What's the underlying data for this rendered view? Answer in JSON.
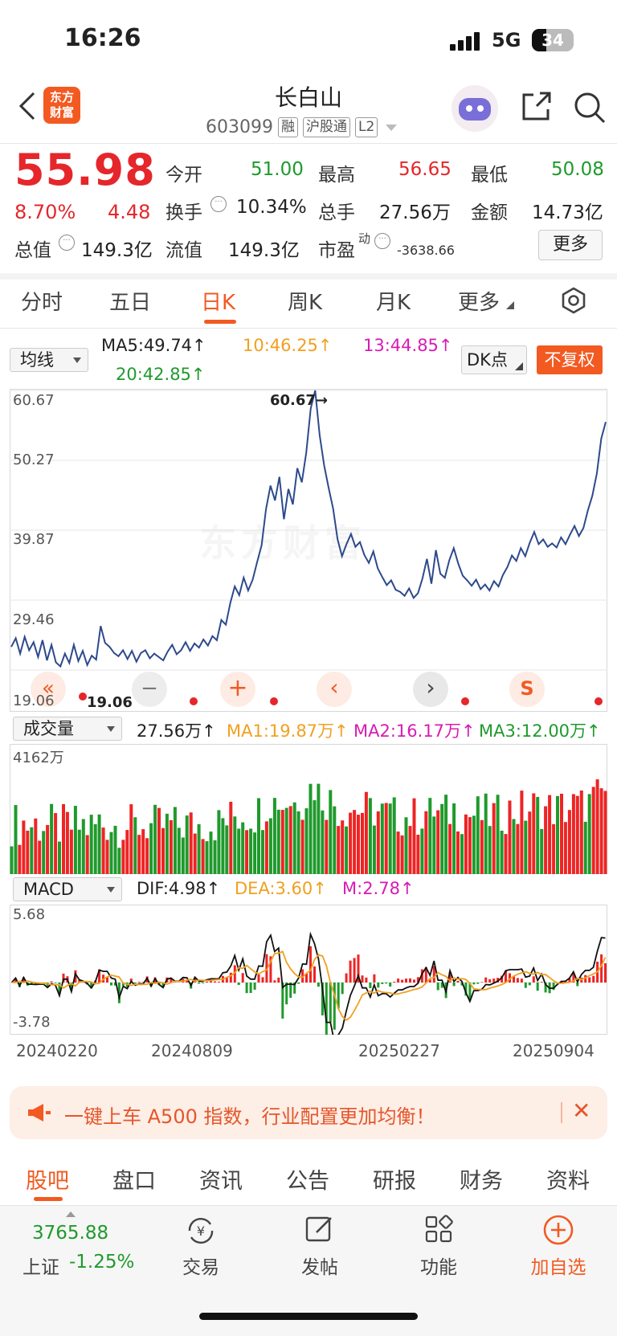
{
  "status_bar": {
    "time": "16:26",
    "network": "5G",
    "battery": "34",
    "battery_level": 0.34
  },
  "header": {
    "title": "长白山",
    "code": "603099",
    "tags": [
      "融",
      "沪股通",
      "L2"
    ],
    "logo_line1": "东方",
    "logo_line2": "财富"
  },
  "quote": {
    "price": "55.98",
    "change_pct": "8.70%",
    "change": "4.48",
    "labels": {
      "open": "今开",
      "high": "最高",
      "low": "最低",
      "turnover": "换手",
      "volume": "总手",
      "amount": "金额",
      "market_cap": "总值",
      "float_cap": "流值",
      "pe": "市盈",
      "pe_sup": "动"
    },
    "values": {
      "open": "51.00",
      "high": "56.65",
      "low": "50.08",
      "turnover": "10.34%",
      "volume": "27.56万",
      "amount": "14.73亿",
      "market_cap": "149.3亿",
      "float_cap": "149.3亿",
      "pe": "-3638.66"
    },
    "more_label": "更多"
  },
  "period_tabs": [
    "分时",
    "五日",
    "日K",
    "周K",
    "月K",
    "更多"
  ],
  "active_period": 2,
  "chart_legend": {
    "selector": "均线",
    "ma5": "MA5:49.74↑",
    "ma10": "10:46.25↑",
    "ma13": "13:44.85↑",
    "ma20": "20:42.85↑",
    "dk_label": "DK点",
    "fq_label": "不复权"
  },
  "volume_legend": {
    "selector": "成交量",
    "vol": "27.56万↑",
    "ma1": "MA1:19.87万↑",
    "ma2": "MA2:16.17万↑",
    "ma3": "MA3:12.00万↑",
    "max_label": "4162万"
  },
  "macd_legend": {
    "selector": "MACD",
    "dif": "DIF:4.98↑",
    "dea": "DEA:3.60↑",
    "m": "M:2.78↑",
    "max_label": "5.68",
    "min_label": "-3.78"
  },
  "chart_data": {
    "type": "line",
    "y_ticks": [
      "60.67",
      "50.27",
      "39.87",
      "29.46",
      "19.06"
    ],
    "ylim": [
      19.06,
      60.67
    ],
    "x_ticks": [
      "20240220",
      "20240809",
      "20250227",
      "20250904"
    ],
    "annotations": {
      "high_label": "60.67→",
      "low_label": "19.06"
    },
    "series": [
      {
        "values": [
          22.5,
          23.8,
          21.5,
          24.0,
          22.0,
          23.2,
          21.0,
          23.5,
          20.5,
          22.8,
          20.2,
          19.6,
          21.5,
          20.1,
          22.8,
          20.4,
          21.9,
          19.8,
          21.2,
          20.6,
          25.6,
          23.1,
          22.5,
          21.6,
          21.1,
          22.0,
          20.7,
          21.9,
          20.3,
          21.6,
          22.0,
          20.8,
          21.5,
          21.0,
          20.5,
          21.8,
          22.8,
          21.4,
          22.0,
          23.2,
          21.9,
          23.0,
          22.4,
          23.6,
          22.7,
          24.1,
          23.5,
          26.5,
          25.8,
          29.0,
          31.5,
          30.2,
          32.8,
          30.9,
          32.5,
          35.1,
          37.6,
          43.0,
          46.5,
          44.3,
          47.8,
          41.5,
          46.0,
          43.7,
          49.1,
          47.0,
          51.4,
          58.0,
          60.67,
          54.0,
          49.5,
          46.2,
          43.1,
          38.5,
          36.0,
          37.8,
          39.3,
          37.4,
          38.1,
          36.2,
          35.0,
          36.7,
          34.2,
          32.9,
          31.7,
          32.4,
          31.0,
          30.7,
          30.1,
          31.2,
          29.8,
          30.5,
          32.7,
          35.6,
          31.9,
          36.9,
          33.4,
          32.8,
          35.4,
          37.2,
          34.9,
          33.1,
          32.4,
          31.6,
          32.5,
          31.1,
          31.8,
          30.9,
          32.3,
          31.5,
          33.2,
          34.4,
          36.1,
          35.3,
          37.2,
          36.0,
          38.0,
          39.6,
          37.8,
          38.5,
          37.4,
          37.9,
          37.3,
          38.8,
          37.8,
          39.2,
          40.5,
          39.0,
          40.2,
          42.8,
          45.0,
          48.3,
          53.5,
          55.98
        ]
      }
    ]
  },
  "notice": {
    "text": "一键上车 A500 指数，行业配置更加均衡！"
  },
  "bottom_tabs": [
    "股吧",
    "盘口",
    "资讯",
    "公告",
    "研报",
    "财务",
    "资料"
  ],
  "active_bottom_tab": 0,
  "tab_bar": {
    "index_value": "3765.88",
    "index_name": "上证",
    "index_change": "-1.25%",
    "items": [
      "交易",
      "发帖",
      "功能",
      "加自选"
    ]
  }
}
